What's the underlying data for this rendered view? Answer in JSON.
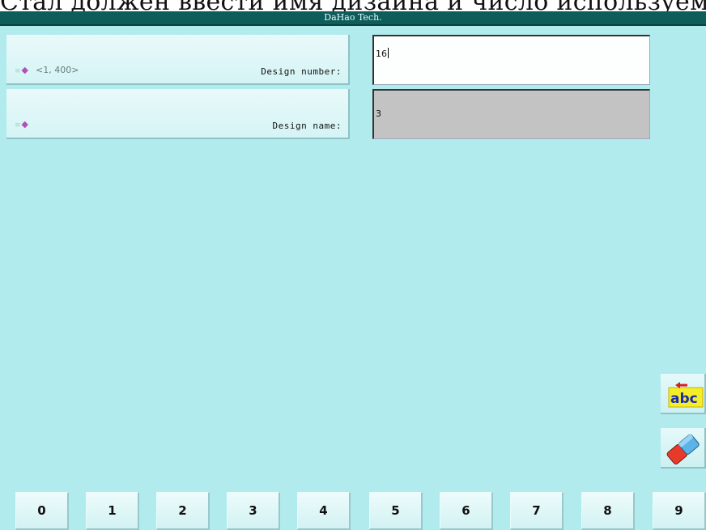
{
  "caption": "Стал должен ввести имя дизайна и число используемых",
  "window": {
    "title": "DaHao Tech."
  },
  "fields": [
    {
      "label": "Design number:",
      "range": "<1, 400>",
      "value": "16"
    },
    {
      "label": "Design name:",
      "range": "",
      "value": "3"
    }
  ],
  "icons": {
    "gem": "gem-bullet-icon",
    "backspace": "abc-backspace-icon",
    "eraser": "eraser-icon"
  },
  "keypad": [
    "0",
    "1",
    "2",
    "3",
    "4",
    "5",
    "6",
    "7",
    "8",
    "9"
  ],
  "colors": {
    "background": "#b2ebed",
    "title_bar": "#0e5d5b",
    "inactive_field": "#c3c3c3"
  }
}
